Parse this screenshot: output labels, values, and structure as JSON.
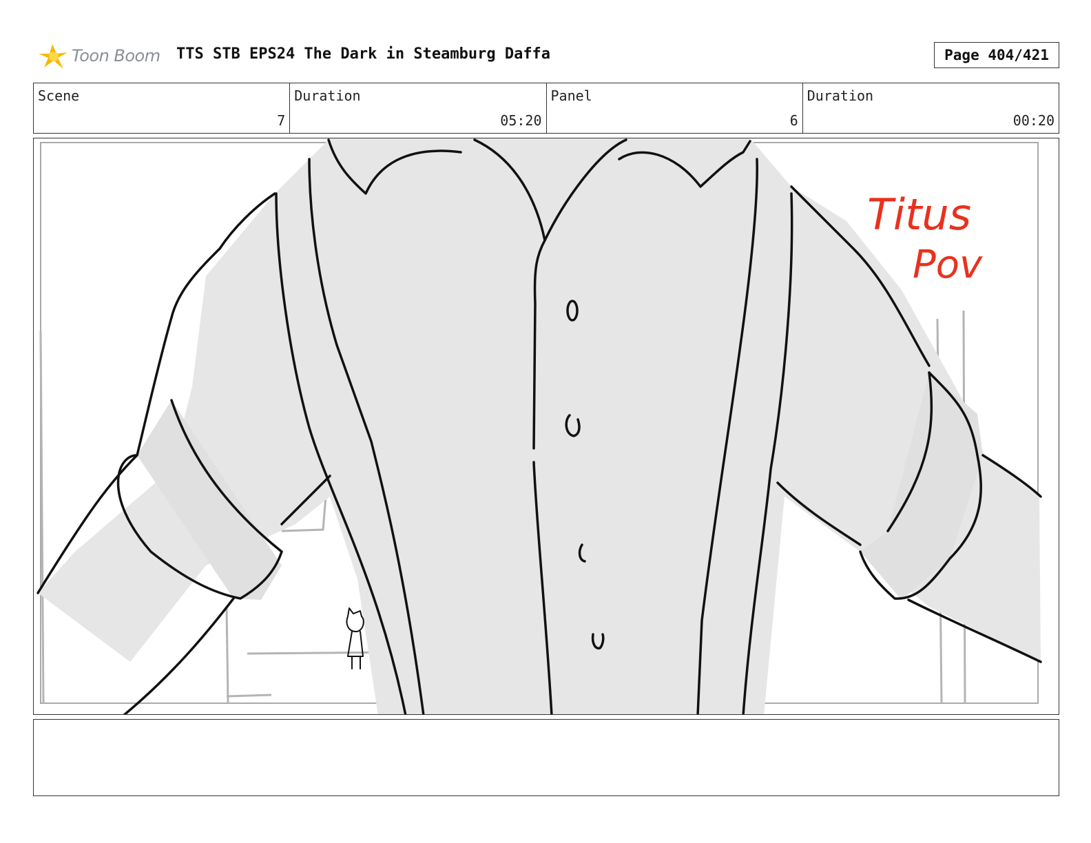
{
  "header": {
    "logo_text": "Toon Boom",
    "title": "TTS STB EPS24 The Dark in Steamburg Daffa",
    "page": "Page 404/421"
  },
  "info": {
    "scene_label": "Scene",
    "scene_value": "7",
    "scene_duration_label": "Duration",
    "scene_duration_value": "05:20",
    "panel_label": "Panel",
    "panel_value": "6",
    "panel_duration_label": "Duration",
    "panel_duration_value": "00:20"
  },
  "panel": {
    "annotation_line1": "Titus",
    "annotation_line2": "Pov",
    "annotation_color": "#e8321e"
  },
  "notes": {
    "text": ""
  }
}
